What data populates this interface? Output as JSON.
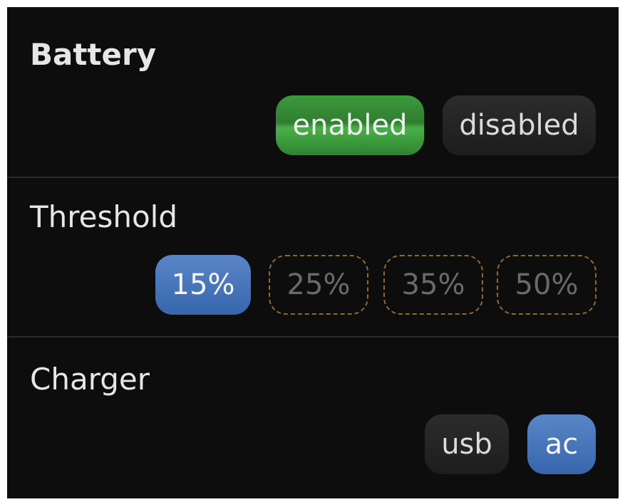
{
  "battery": {
    "title": "Battery",
    "options": [
      {
        "label": "enabled",
        "selected": true
      },
      {
        "label": "disabled",
        "selected": false
      }
    ]
  },
  "threshold": {
    "title": "Threshold",
    "options": [
      {
        "label": "15%",
        "selected": true
      },
      {
        "label": "25%",
        "selected": false
      },
      {
        "label": "35%",
        "selected": false
      },
      {
        "label": "50%",
        "selected": false
      }
    ]
  },
  "charger": {
    "title": "Charger",
    "options": [
      {
        "label": "usb",
        "selected": false
      },
      {
        "label": "ac",
        "selected": true
      }
    ]
  },
  "colors": {
    "panel_bg": "#0d0d0d",
    "enabled_green": "#3a9a3a",
    "selected_blue": "#4675bc",
    "unselected_dark": "#262626",
    "dashed_border": "#8a6a2e"
  }
}
